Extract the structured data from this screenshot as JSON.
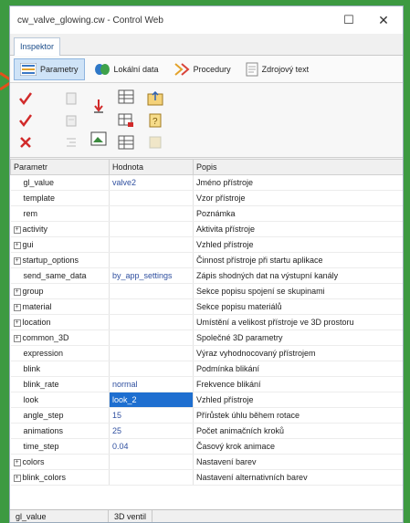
{
  "window": {
    "title": "cw_valve_glowing.cw - Control Web",
    "maximize_glyph": "☐",
    "close_glyph": "✕"
  },
  "tab": {
    "label": "Inspektor"
  },
  "subtabs": [
    {
      "label": "Parametry",
      "icon": "parameters-icon",
      "active": true
    },
    {
      "label": "Lokální data",
      "icon": "local-data-icon",
      "active": false
    },
    {
      "label": "Procedury",
      "icon": "procedures-icon",
      "active": false
    },
    {
      "label": "Zdrojový text",
      "icon": "source-text-icon",
      "active": false
    }
  ],
  "grid": {
    "headers": [
      "Parametr",
      "Hodnota",
      "Popis"
    ],
    "rows": [
      {
        "param": "gl_value",
        "value": "valve2",
        "desc": "Jméno přístroje",
        "group": false,
        "indent": true
      },
      {
        "param": "template",
        "value": "",
        "desc": "Vzor přístroje",
        "group": false,
        "indent": true
      },
      {
        "param": "rem",
        "value": "",
        "desc": "Poznámka",
        "group": false,
        "indent": true
      },
      {
        "param": "activity",
        "value": "",
        "desc": "Aktivita přístroje",
        "group": true,
        "indent": false
      },
      {
        "param": "gui",
        "value": "",
        "desc": "Vzhled přístroje",
        "group": true,
        "indent": false
      },
      {
        "param": "startup_options",
        "value": "",
        "desc": "Činnost přístroje při startu aplikace",
        "group": true,
        "indent": false
      },
      {
        "param": "send_same_data",
        "value": "by_app_settings",
        "desc": "Zápis shodných dat na výstupní kanály",
        "group": false,
        "indent": true
      },
      {
        "param": "group",
        "value": "",
        "desc": "Sekce popisu spojení se skupinami",
        "group": true,
        "indent": false
      },
      {
        "param": "material",
        "value": "",
        "desc": "Sekce popisu materiálů",
        "group": true,
        "indent": false
      },
      {
        "param": "location",
        "value": "",
        "desc": "Umístění a velikost přístroje ve 3D prostoru",
        "group": true,
        "indent": false
      },
      {
        "param": "common_3D",
        "value": "",
        "desc": "Společné 3D parametry",
        "group": true,
        "indent": false
      },
      {
        "param": "expression",
        "value": "",
        "desc": "Výraz vyhodnocovaný přístrojem",
        "group": false,
        "indent": true
      },
      {
        "param": "blink",
        "value": "",
        "desc": "Podmínka blikání",
        "group": false,
        "indent": true
      },
      {
        "param": "blink_rate",
        "value": "normal",
        "desc": "Frekvence blikání",
        "group": false,
        "indent": true
      },
      {
        "param": "look",
        "value": "look_2",
        "desc": "Vzhled přístroje",
        "group": false,
        "indent": true,
        "selected": true
      },
      {
        "param": "angle_step",
        "value": "15",
        "desc": "Přírůstek úhlu během rotace",
        "group": false,
        "indent": true
      },
      {
        "param": "animations",
        "value": "25",
        "desc": "Počet animačních kroků",
        "group": false,
        "indent": true
      },
      {
        "param": "time_step",
        "value": "0.04",
        "desc": "Časový krok animace",
        "group": false,
        "indent": true
      },
      {
        "param": "colors",
        "value": "",
        "desc": "Nastavení barev",
        "group": true,
        "indent": false
      },
      {
        "param": "blink_colors",
        "value": "",
        "desc": "Nastavení alternativních barev",
        "group": true,
        "indent": false
      }
    ]
  },
  "status": {
    "left": "gl_value",
    "right": "3D ventil"
  }
}
